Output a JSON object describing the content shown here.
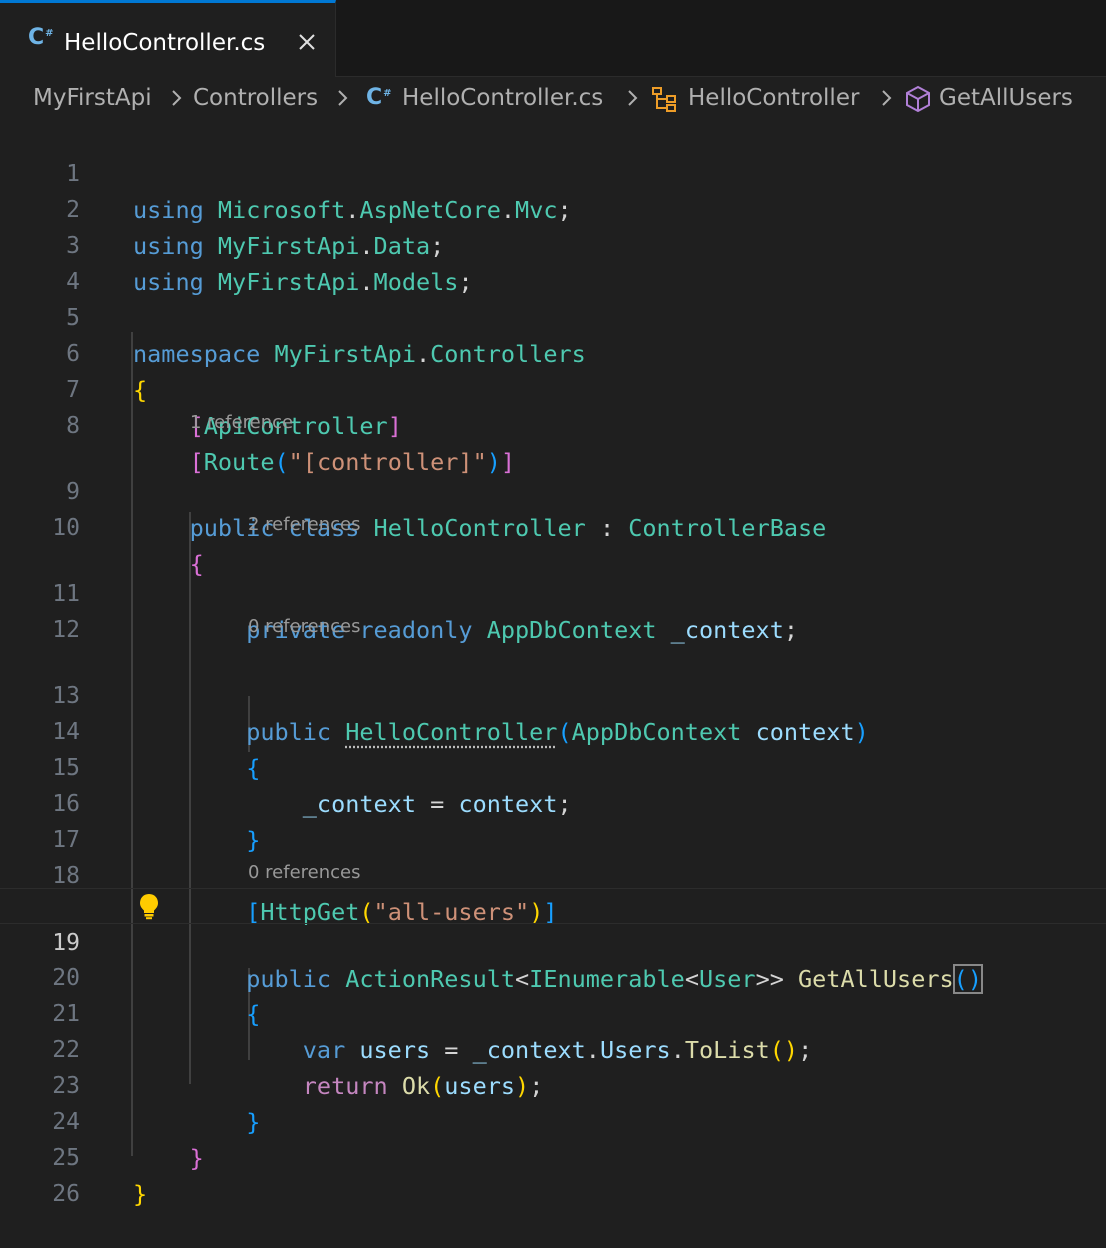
{
  "tab": {
    "filename": "HelloController.cs",
    "icon": "csharp-file-icon"
  },
  "breadcrumbs": {
    "project": "MyFirstApi",
    "folder": "Controllers",
    "file": "HelloController.cs",
    "class": "HelloController",
    "method": "GetAllUsers"
  },
  "gutter": [
    "1",
    "2",
    "3",
    "4",
    "5",
    "6",
    "7",
    "8",
    "9",
    "10",
    "11",
    "12",
    "13",
    "14",
    "15",
    "16",
    "17",
    "18",
    "19",
    "20",
    "21",
    "22",
    "23",
    "24",
    "25",
    "26"
  ],
  "current_line": "19",
  "codelens": {
    "class_refs": "1 reference",
    "field_refs": "2 references",
    "ctor_refs": "0 references",
    "method_refs": "0 references"
  },
  "code": {
    "l1": [
      "using",
      "Microsoft",
      ".",
      "AspNetCore",
      ".",
      "Mvc",
      ";"
    ],
    "l2": [
      "using",
      "MyFirstApi",
      ".",
      "Data",
      ";"
    ],
    "l3": [
      "using",
      "MyFirstApi",
      ".",
      "Models",
      ";"
    ],
    "l5": [
      "namespace",
      "MyFirstApi",
      ".",
      "Controllers"
    ],
    "l6": [
      "{"
    ],
    "l7": [
      "[",
      "ApiController",
      "]"
    ],
    "l8": [
      "[",
      "Route",
      "(",
      "\"[controller]\"",
      ")",
      "]"
    ],
    "l9": [
      "public",
      "class",
      "HelloController",
      ":",
      "ControllerBase"
    ],
    "l10": [
      "{"
    ],
    "l11": [
      "private",
      "readonly",
      "AppDbContext",
      "_context",
      ";"
    ],
    "l13": [
      "public",
      "HelloController",
      "(",
      "AppDbContext",
      "context",
      ")"
    ],
    "l14": [
      "{"
    ],
    "l15": [
      "_context",
      "=",
      "context",
      ";"
    ],
    "l16": [
      "}"
    ],
    "l18": [
      "[",
      "HttpGet",
      "(",
      "\"all-users\"",
      ")",
      "]"
    ],
    "l19": [
      "public",
      "ActionResult",
      "<",
      "IEnumerable",
      "<",
      "User",
      ">>",
      "GetAllUsers",
      "(",
      ")"
    ],
    "l20": [
      "{"
    ],
    "l21": [
      "var",
      "users",
      "=",
      "_context",
      ".",
      "Users",
      ".",
      "ToList",
      "(",
      ")",
      ";"
    ],
    "l22": [
      "return",
      "Ok",
      "(",
      "users",
      ")",
      ";"
    ],
    "l23": [
      "}"
    ],
    "l24": [
      "}"
    ],
    "l25": [
      "}"
    ]
  },
  "colors": {
    "keyword": "#569cd6",
    "control": "#c586c0",
    "type": "#4ec9b0",
    "function": "#dcdcaa",
    "variable": "#9cdcfe",
    "string": "#ce9178",
    "bracket_level1": "#ffd700",
    "bracket_level2": "#da70d6",
    "bracket_level3": "#179fff"
  }
}
